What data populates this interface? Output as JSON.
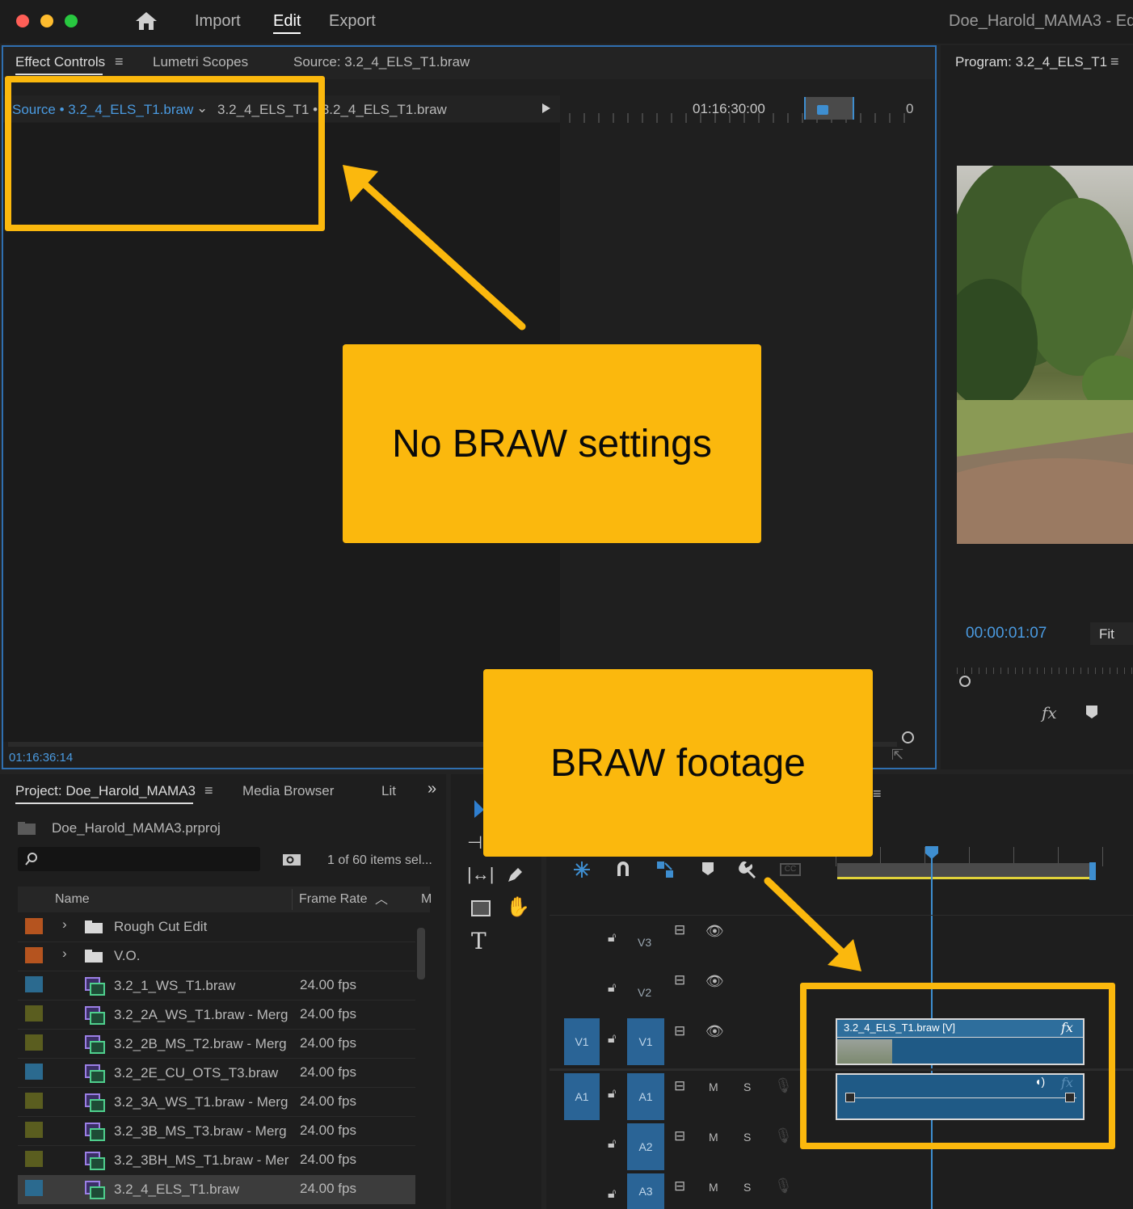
{
  "menubar": {
    "import": "Import",
    "edit": "Edit",
    "export": "Export",
    "project_title": "Doe_Harold_MAMA3 - Ed"
  },
  "effect_panel": {
    "tab_effect_controls": "Effect Controls",
    "tab_lumetri": "Lumetri Scopes",
    "tab_source": "Source: 3.2_4_ELS_T1.braw",
    "source_label": "Source • 3.2_4_ELS_T1.braw",
    "clip_label": "3.2_4_ELS_T1 • 3.2_4_ELS_T1.braw",
    "ruler_timecode": "01:16:30:00",
    "ruler_end": "0",
    "current_timecode": "01:16:36:14"
  },
  "program_panel": {
    "title": "Program: 3.2_4_ELS_T1",
    "timecode": "00:00:01:07",
    "fit": "Fit"
  },
  "project_panel": {
    "tab_project": "Project: Doe_Harold_MAMA3",
    "tab_media_browser": "Media Browser",
    "tab_lib": "Lit",
    "project_file": "Doe_Harold_MAMA3.prproj",
    "selection_info": "1 of 60 items sel...",
    "col_name": "Name",
    "col_frame_rate": "Frame Rate",
    "col_m": "M",
    "items": [
      {
        "name": "Rough Cut Edit",
        "fps": "",
        "color": "#b5541f",
        "type": "folder"
      },
      {
        "name": "V.O.",
        "fps": "",
        "color": "#b5541f",
        "type": "folder"
      },
      {
        "name": "3.2_1_WS_T1.braw",
        "fps": "24.00 fps",
        "color": "#2b6a8f",
        "type": "clip"
      },
      {
        "name": "3.2_2A_WS_T1.braw - Merg",
        "fps": "24.00 fps",
        "color": "#5a5d1f",
        "type": "clip"
      },
      {
        "name": "3.2_2B_MS_T2.braw - Merg",
        "fps": "24.00 fps",
        "color": "#5a5d1f",
        "type": "clip"
      },
      {
        "name": "3.2_2E_CU_OTS_T3.braw",
        "fps": "24.00 fps",
        "color": "#2b6a8f",
        "type": "clip"
      },
      {
        "name": "3.2_3A_WS_T1.braw - Merg",
        "fps": "24.00 fps",
        "color": "#5a5d1f",
        "type": "clip"
      },
      {
        "name": "3.2_3B_MS_T3.braw - Merg",
        "fps": "24.00 fps",
        "color": "#5a5d1f",
        "type": "clip"
      },
      {
        "name": "3.2_3BH_MS_T1.braw - Mer",
        "fps": "24.00 fps",
        "color": "#5a5d1f",
        "type": "clip"
      },
      {
        "name": "3.2_4_ELS_T1.braw",
        "fps": "24.00 fps",
        "color": "#2b6a8f",
        "type": "clip",
        "selected": true
      }
    ]
  },
  "timeline": {
    "tracks": {
      "v3": "V3",
      "v2": "V2",
      "v1": "V1",
      "a1": "A1",
      "a2": "A2",
      "a3": "A3",
      "v1_src": "V1",
      "a1_src": "A1",
      "m": "M",
      "s": "S"
    },
    "clip_video_label": "3.2_4_ELS_T1.braw [V]",
    "fx": "fx"
  },
  "callouts": {
    "no_braw": "No BRAW settings",
    "braw_footage": "BRAW footage"
  },
  "colors": {
    "accent_blue": "#3e8ed0",
    "callout_yellow": "#fbb80d",
    "clip_blue": "#1f5a86"
  }
}
